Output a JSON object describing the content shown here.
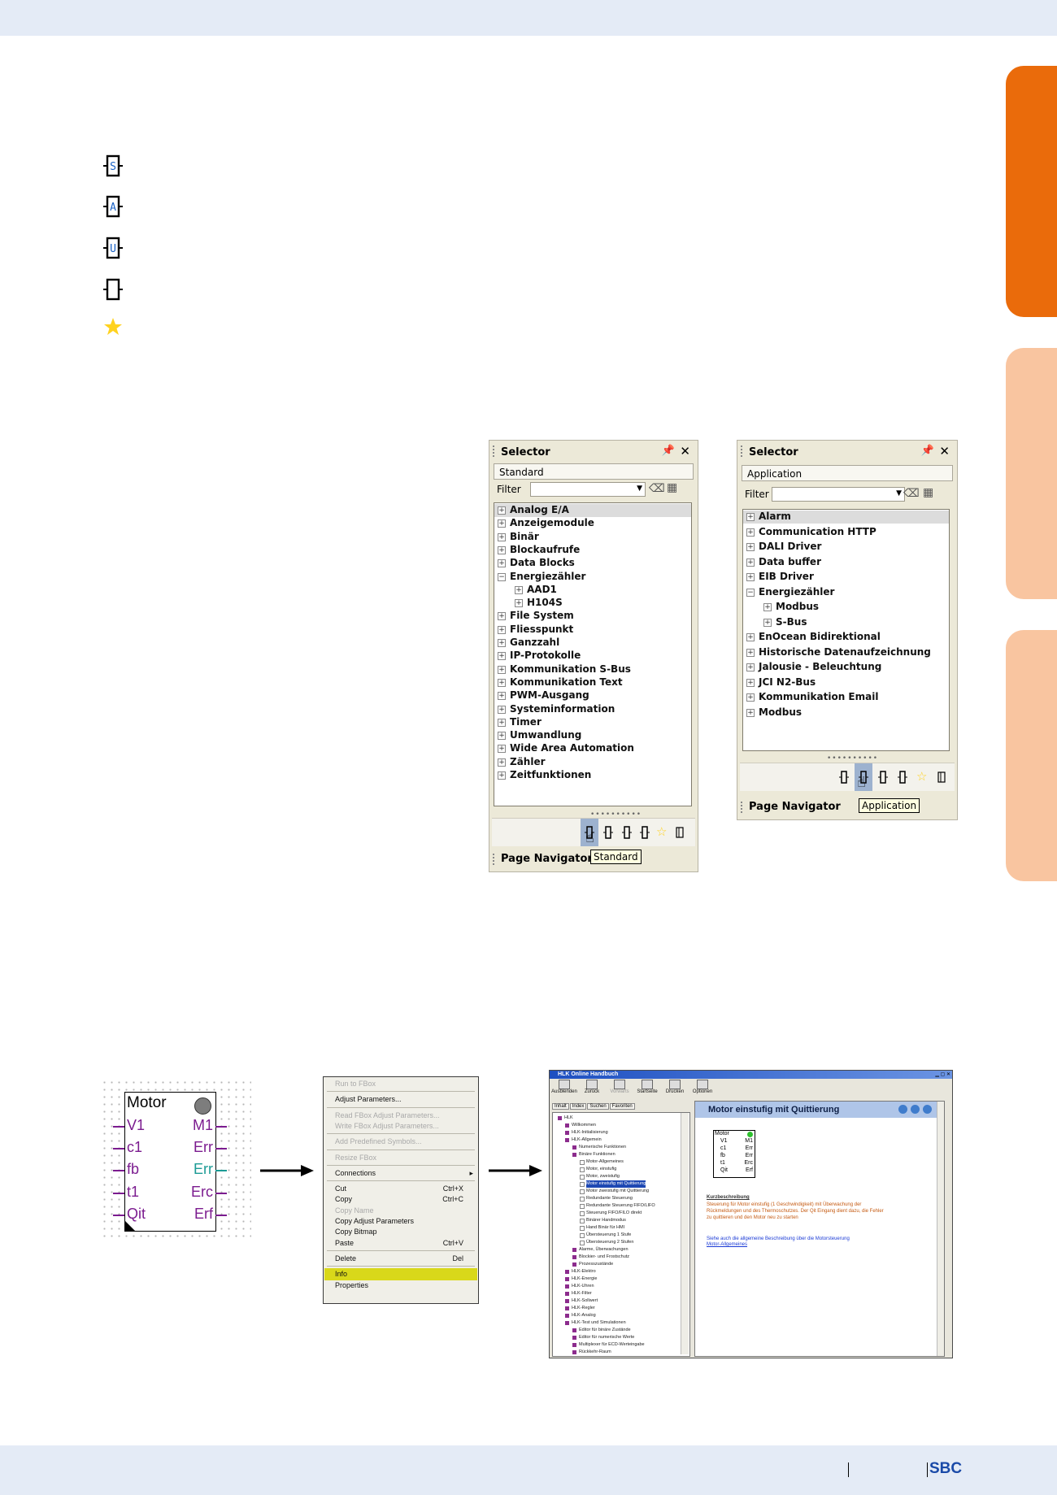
{
  "colors": {
    "tab_active": "#ea6b0b",
    "tab_inactive": "#f9c5a0",
    "band": "#e4ebf6",
    "pin_purple": "#7b1b8f",
    "pin_teal": "#1c9b95",
    "menu_highlight": "#d9d81a",
    "sbc_blue": "#1a4aa8"
  },
  "side_icons": [
    "fbox-s-icon",
    "fbox-a-icon",
    "fbox-u-icon",
    "fbox-empty-icon",
    "favorites-star-icon"
  ],
  "selector_left": {
    "title": "Selector",
    "mode": "Standard",
    "filter_label": "Filter",
    "items": [
      {
        "label": "Analog E/A",
        "sign": "+",
        "level": 0,
        "selected": true
      },
      {
        "label": "Anzeigemodule",
        "sign": "+",
        "level": 0
      },
      {
        "label": "Binär",
        "sign": "+",
        "level": 0
      },
      {
        "label": "Blockaufrufe",
        "sign": "+",
        "level": 0
      },
      {
        "label": "Data Blocks",
        "sign": "+",
        "level": 0
      },
      {
        "label": "Energiezähler",
        "sign": "−",
        "level": 0
      },
      {
        "label": "AAD1",
        "sign": "+",
        "level": 1
      },
      {
        "label": "H104S",
        "sign": "+",
        "level": 1
      },
      {
        "label": "File System",
        "sign": "+",
        "level": 0
      },
      {
        "label": "Fliesspunkt",
        "sign": "+",
        "level": 0
      },
      {
        "label": "Ganzzahl",
        "sign": "+",
        "level": 0
      },
      {
        "label": "IP-Protokolle",
        "sign": "+",
        "level": 0
      },
      {
        "label": "Kommunikation S-Bus",
        "sign": "+",
        "level": 0
      },
      {
        "label": "Kommunikation Text",
        "sign": "+",
        "level": 0
      },
      {
        "label": "PWM-Ausgang",
        "sign": "+",
        "level": 0
      },
      {
        "label": "Systeminformation",
        "sign": "+",
        "level": 0
      },
      {
        "label": "Timer",
        "sign": "+",
        "level": 0
      },
      {
        "label": "Umwandlung",
        "sign": "+",
        "level": 0
      },
      {
        "label": "Wide Area Automation",
        "sign": "+",
        "level": 0
      },
      {
        "label": "Zähler",
        "sign": "+",
        "level": 0
      },
      {
        "label": "Zeitfunktionen",
        "sign": "+",
        "level": 0
      }
    ],
    "splitter": "••••••••••",
    "page_navigator": "Page Navigator",
    "tooltip": "Standard"
  },
  "selector_right": {
    "title": "Selector",
    "mode": "Application",
    "filter_label": "Filter",
    "items": [
      {
        "label": "Alarm",
        "sign": "+",
        "level": 0,
        "selected": true
      },
      {
        "label": "Communication HTTP",
        "sign": "+",
        "level": 0
      },
      {
        "label": "DALI Driver",
        "sign": "+",
        "level": 0
      },
      {
        "label": "Data buffer",
        "sign": "+",
        "level": 0
      },
      {
        "label": "EIB Driver",
        "sign": "+",
        "level": 0
      },
      {
        "label": "Energiezähler",
        "sign": "−",
        "level": 0
      },
      {
        "label": "Modbus",
        "sign": "+",
        "level": 1
      },
      {
        "label": "S-Bus",
        "sign": "+",
        "level": 1
      },
      {
        "label": "EnOcean Bidirektional",
        "sign": "+",
        "level": 0
      },
      {
        "label": "Historische Datenaufzeichnung",
        "sign": "+",
        "level": 0
      },
      {
        "label": "Jalousie - Beleuchtung",
        "sign": "+",
        "level": 0
      },
      {
        "label": "JCI N2-Bus",
        "sign": "+",
        "level": 0
      },
      {
        "label": "Kommunikation Email",
        "sign": "+",
        "level": 0
      },
      {
        "label": "Modbus",
        "sign": "+",
        "level": 0
      }
    ],
    "splitter": "••••••••••",
    "page_navigator": "Page Navigator",
    "tooltip": "Application"
  },
  "fbox": {
    "title": "Motor",
    "left_pins": [
      "V1",
      "c1",
      "fb",
      "t1",
      "Qit"
    ],
    "right_pins": [
      "M1",
      "Err",
      "Err",
      "Erc",
      "Erf"
    ]
  },
  "context_menu": {
    "items": [
      {
        "label": "Run to FBox",
        "disabled": true
      },
      {
        "sep": true
      },
      {
        "label": "Adjust Parameters..."
      },
      {
        "sep": true
      },
      {
        "label": "Read FBox Adjust Parameters...",
        "disabled": true
      },
      {
        "label": "Write FBox Adjust Parameters...",
        "disabled": true
      },
      {
        "sep": true
      },
      {
        "label": "Add Predefined Symbols...",
        "disabled": true
      },
      {
        "sep": true
      },
      {
        "label": "Resize FBox",
        "disabled": true
      },
      {
        "sep": true
      },
      {
        "label": "Connections",
        "submenu": true
      },
      {
        "sep": true
      },
      {
        "label": "Cut",
        "shortcut": "Ctrl+X"
      },
      {
        "label": "Copy",
        "shortcut": "Ctrl+C"
      },
      {
        "label": "Copy Name",
        "disabled": true
      },
      {
        "label": "Copy Adjust Parameters"
      },
      {
        "label": "Copy Bitmap"
      },
      {
        "label": "Paste",
        "shortcut": "Ctrl+V"
      },
      {
        "sep": true
      },
      {
        "label": "Delete",
        "shortcut": "Del"
      },
      {
        "sep": true
      },
      {
        "label": "Info",
        "highlight": true
      },
      {
        "label": "Properties"
      }
    ]
  },
  "help_window": {
    "title": "HLK Online Handbuch",
    "toolbar": [
      "Ausblenden",
      "Zurück",
      "Vorwärts",
      "Startseite",
      "Drucken",
      "Optionen"
    ],
    "tabs": [
      "Inhalt",
      "Index",
      "Suchen",
      "Favoriten"
    ],
    "tree": [
      {
        "label": "HLK",
        "level": 0
      },
      {
        "label": "Willkommen",
        "level": 1
      },
      {
        "label": "HLK-Initialisierung",
        "level": 1
      },
      {
        "label": "HLK-Allgemein",
        "level": 1
      },
      {
        "label": "Numerische Funktionen",
        "level": 2
      },
      {
        "label": "Binäre Funktionen",
        "level": 2
      },
      {
        "label": "Motor-Allgemeines",
        "level": 3
      },
      {
        "label": "Motor, einstufig",
        "level": 3
      },
      {
        "label": "Motor, zweistufig",
        "level": 3
      },
      {
        "label": "Motor einstufig mit Quittierung",
        "level": 3,
        "selected": true
      },
      {
        "label": "Motor zweistufig mit Quittierung",
        "level": 3
      },
      {
        "label": "Redundante Steuerung",
        "level": 3
      },
      {
        "label": "Redundante Steuerung FIFO/LIFO",
        "level": 3
      },
      {
        "label": "Steuerung FIFO/FILO direkt",
        "level": 3
      },
      {
        "label": "Binärer Handmodus",
        "level": 3
      },
      {
        "label": "Hand Binär für HMI",
        "level": 3
      },
      {
        "label": "Übersteuerung 1 Stufe",
        "level": 3
      },
      {
        "label": "Übersteuerung 2 Stufen",
        "level": 3
      },
      {
        "label": "Alarme, Überwachungen",
        "level": 2
      },
      {
        "label": "Blockier- und Frostschutz",
        "level": 2
      },
      {
        "label": "Prozesszustände",
        "level": 2
      },
      {
        "label": "HLK-Elektro",
        "level": 1
      },
      {
        "label": "HLK-Energie",
        "level": 1
      },
      {
        "label": "HLK-Uhren",
        "level": 1
      },
      {
        "label": "HLK-Filter",
        "level": 1
      },
      {
        "label": "HLK-Sollwert",
        "level": 1
      },
      {
        "label": "HLK-Regler",
        "level": 1
      },
      {
        "label": "HLK-Analog",
        "level": 1
      },
      {
        "label": "HLK-Test und Simulationen",
        "level": 1
      },
      {
        "label": "Editor für binäre Zustände",
        "level": 2
      },
      {
        "label": "Editor für numerische Werte",
        "level": 2
      },
      {
        "label": "Multiplexer für ECD-Werteingabe",
        "level": 2
      },
      {
        "label": "Rückkehr-Raum",
        "level": 2
      }
    ],
    "heading": "Motor einstufig mit Quittierung",
    "mini_fbox": {
      "title": "Motor",
      "left": [
        "V1",
        "c1",
        "fb",
        "t1",
        "Qit"
      ],
      "right": [
        "M1",
        "Err",
        "Err",
        "Erc",
        "Erf"
      ]
    },
    "kurz_label": "Kurzbeschreibung",
    "kurz_lines": [
      "Steuerung für Motor einstufig (1 Geschwindigkeit) mit Überwachung der",
      "Rückmeldungen und des Thermoschutzes. Der Qit Eingang dient dazu, die Fehler",
      "zu quittieren und den Motor neu zu starten"
    ],
    "see_also": "Siehe auch die allgemeine Beschreibung über die Motorsteuerung",
    "link": "Motor-Allgemeines"
  },
  "footer": {
    "brand": "SBC"
  }
}
